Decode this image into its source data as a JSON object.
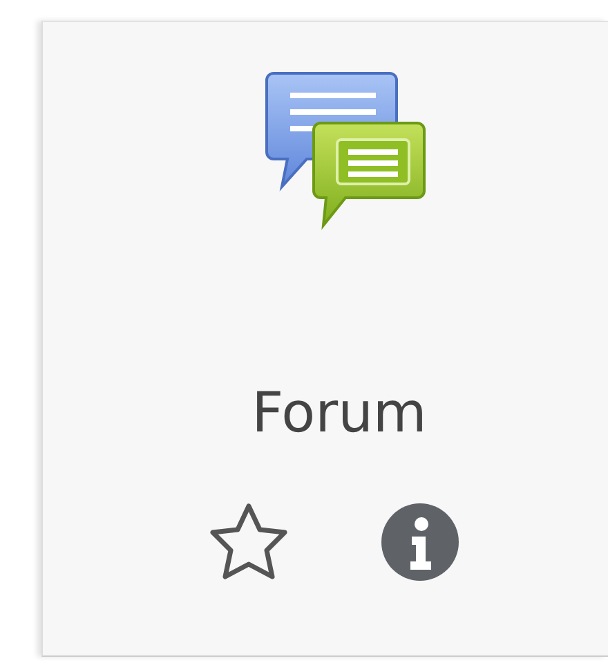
{
  "activity": {
    "title": "Forum",
    "starred": false
  }
}
